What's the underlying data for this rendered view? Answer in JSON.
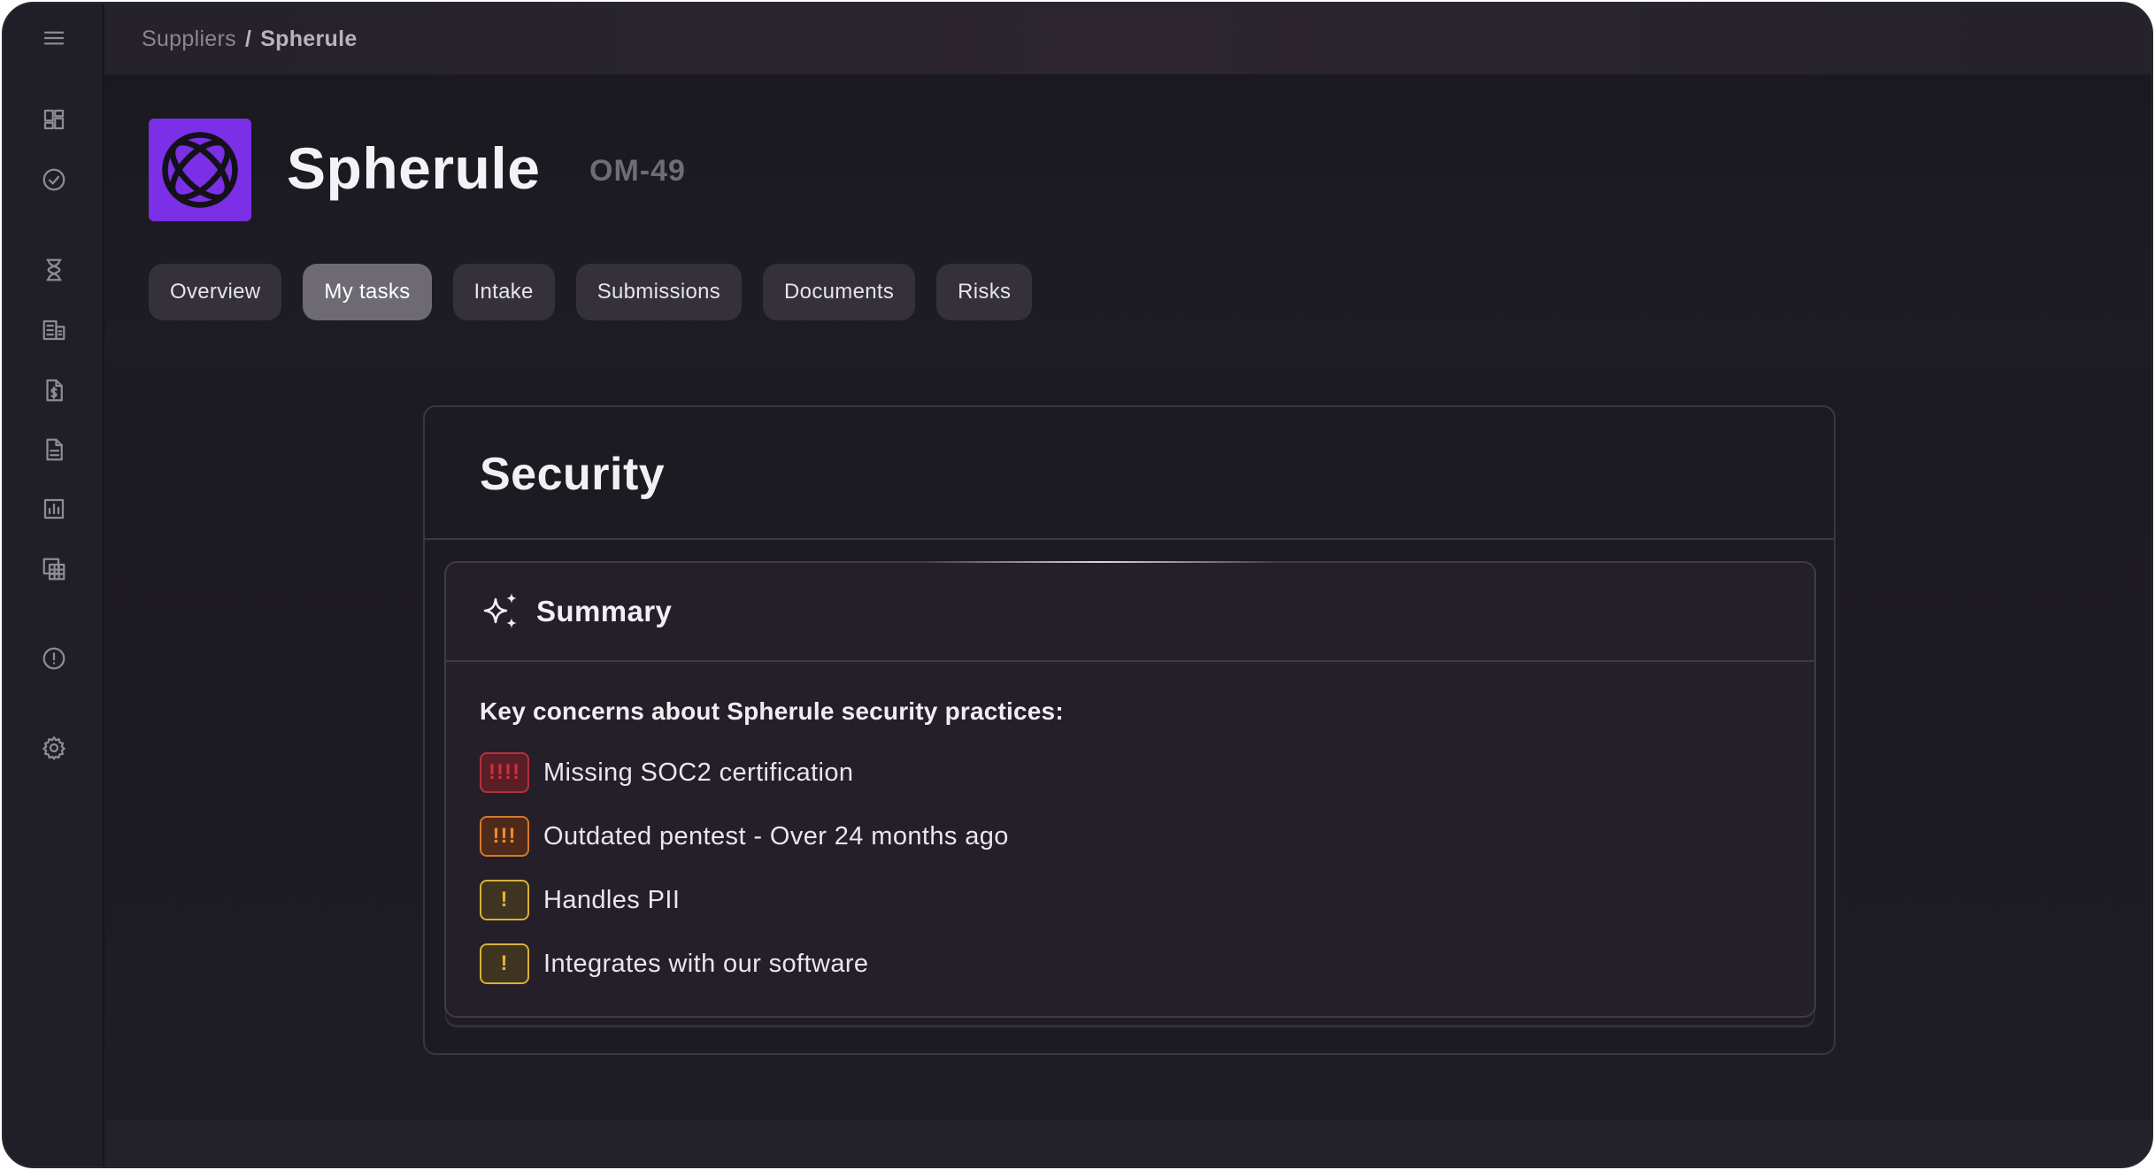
{
  "breadcrumb": {
    "parent": "Suppliers",
    "separator": "/",
    "current": "Spherule"
  },
  "supplier": {
    "name": "Spherule",
    "id": "OM-49",
    "logo_color": "#7b2fe6"
  },
  "tabs": [
    {
      "label": "Overview",
      "active": false
    },
    {
      "label": "My tasks",
      "active": true
    },
    {
      "label": "Intake",
      "active": false
    },
    {
      "label": "Submissions",
      "active": false
    },
    {
      "label": "Documents",
      "active": false
    },
    {
      "label": "Risks",
      "active": false
    }
  ],
  "sidebar": {
    "icons": [
      "menu-icon",
      "dashboard-icon",
      "check-circle-icon",
      "hourglass-icon",
      "building-icon",
      "invoice-icon",
      "document-icon",
      "chart-icon",
      "table-icon",
      "alert-icon",
      "settings-icon"
    ]
  },
  "card": {
    "title": "Security",
    "summary": {
      "title": "Summary",
      "intro": "Key concerns about Spherule security practices:",
      "concerns": [
        {
          "badge": "!!!!",
          "level": "critical",
          "text": "Missing SOC2 certification"
        },
        {
          "badge": "!!!",
          "level": "high",
          "text": "Outdated pentest - Over 24 months ago"
        },
        {
          "badge": "!",
          "level": "medium",
          "text": "Handles PII"
        },
        {
          "badge": "!",
          "level": "medium",
          "text": "Integrates with our software"
        }
      ]
    }
  },
  "colors": {
    "critical": "#d0303c",
    "high": "#f08a2c",
    "medium": "#e2b538",
    "active_tab": "#6d6a73"
  }
}
